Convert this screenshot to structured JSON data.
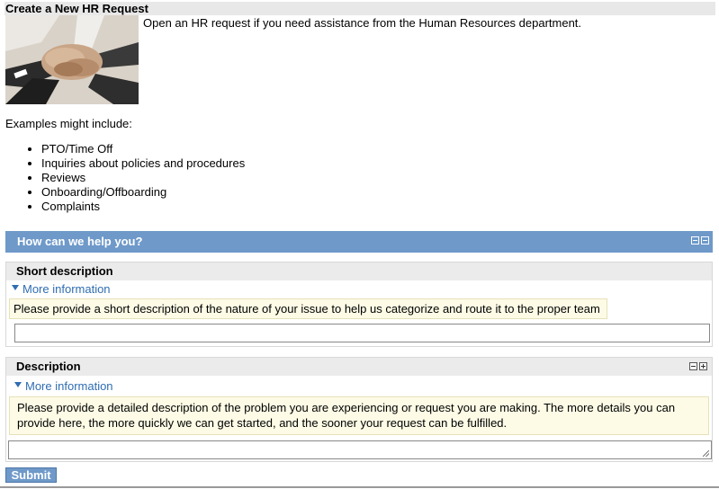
{
  "page": {
    "title": "Create a New HR Request",
    "intro": "Open an HR request if you need assistance from the Human Resources department.",
    "examples_label": "Examples might include:",
    "examples": [
      "PTO/Time Off",
      "Inquiries about policies and procedures",
      "Reviews",
      "Onboarding/Offboarding",
      "Complaints"
    ]
  },
  "help_section": {
    "title": "How can we help you?",
    "icons": [
      "minimize-icon",
      "collapse-icon"
    ]
  },
  "short_description": {
    "label": "Short description",
    "more_info": "More information",
    "hint": "Please provide a short description of the nature of your issue to help us categorize and route it to the proper team",
    "value": ""
  },
  "description": {
    "label": "Description",
    "more_info": "More information",
    "hint": "Please provide a detailed description of the problem you are experiencing or request you are making. The more details you can provide here, the more quickly we can get started, and the sooner your request can be fulfilled.",
    "value": "",
    "icons": [
      "collapse-icon",
      "expand-icon"
    ]
  },
  "actions": {
    "submit_label": "Submit"
  },
  "colors": {
    "accent_bar": "#6e99c9",
    "link": "#2f6db2",
    "hint_bg": "#fdfbe6"
  },
  "hero_image": "hands-stacked-teamwork-photo"
}
